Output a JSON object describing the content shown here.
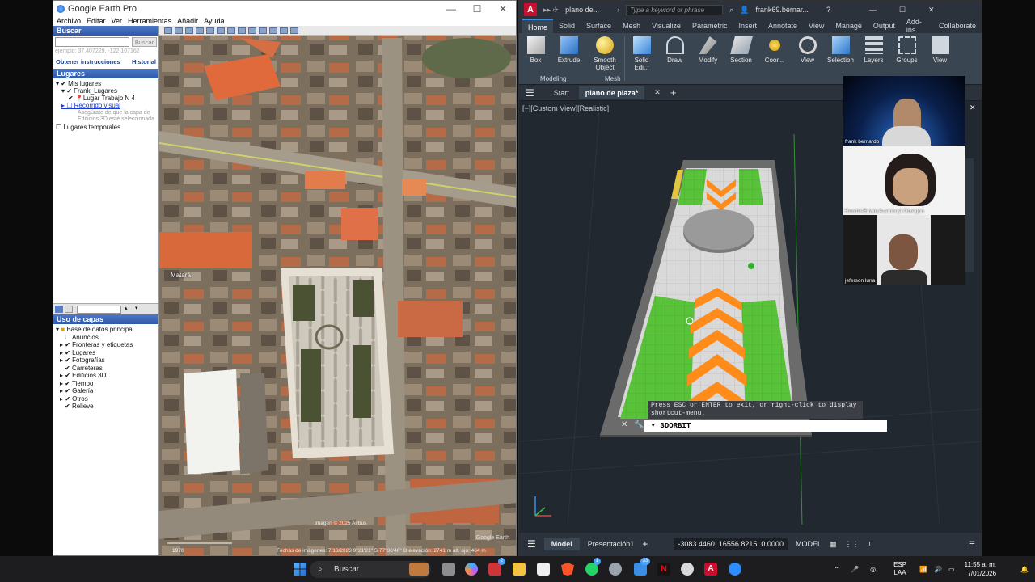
{
  "google_earth": {
    "title": "Google Earth Pro",
    "menu": [
      "Archivo",
      "Editar",
      "Ver",
      "Herramientas",
      "Añadir",
      "Ayuda"
    ],
    "search_header": "Buscar",
    "search_button": "Buscar",
    "search_placeholder": "ejemplo: 37.407229, -122.107162",
    "links": [
      "Obtener instrucciones",
      "Historial"
    ],
    "places_header": "Lugares",
    "places": [
      "Mis lugares",
      "Frank_Lugares",
      "Lugar Trabajo N 4",
      "Recorrido visual",
      "Asegúrate de que la capa de",
      "Edificios 3D esté seleccionada",
      "Lugares temporales"
    ],
    "layers_header": "Uso de capas",
    "layers": [
      "Base de datos principal",
      "Anuncios",
      "Fronteras y etiquetas",
      "Lugares",
      "Fotografías",
      "Carreteras",
      "Edificios 3D",
      "Tiempo",
      "Galería",
      "Otros",
      "Relieve"
    ],
    "map_label": "Matará",
    "imagery_credit": "Imagen © 2025 Airbus",
    "status_bar": "Fechas de imágenes: 7/13/2023   9°21'21\" S   77°36'40\" O   elevación: 2741 m   alt. ojo: 464 m",
    "scale": "1970",
    "watermark": "Google Earth"
  },
  "autocad": {
    "logo": "A",
    "doc_title": "plano de...",
    "search_placeholder": "Type a keyword or phrase",
    "user": "frank69.bernar...",
    "ribbon_tabs": [
      "Home",
      "Solid",
      "Surface",
      "Mesh",
      "Visualize",
      "Parametric",
      "Insert",
      "Annotate",
      "View",
      "Manage",
      "Output",
      "Add-ins",
      "Collaborate"
    ],
    "ribbon_buttons": [
      "Box",
      "Extrude",
      "Smooth Object",
      "Solid Edi...",
      "Draw",
      "Modify",
      "Section",
      "Coor...",
      "View",
      "Selection",
      "Layers",
      "Groups",
      "View"
    ],
    "panel_labels": [
      "Modeling",
      "Mesh"
    ],
    "doc_tabs": [
      "Start",
      "plano de plaza*"
    ],
    "viewport_label": "[−][Custom View][Realistic]",
    "cmd_hint": "Press ESC or ENTER to exit, or right-click to display shortcut-menu.",
    "cmd_value": "3DORBIT",
    "status_tabs": [
      "Model",
      "Presentación1"
    ],
    "coords": "-3083.4460, 16556.8215, 0.0000",
    "mode": "MODEL"
  },
  "participants": [
    {
      "name": "frank bernardo"
    },
    {
      "name": "Randal Edwin Azambuja Obregón"
    },
    {
      "name": "jeferson luna"
    }
  ],
  "taskbar": {
    "search_label": "Buscar",
    "language": "ESP",
    "language_sub": "LAA",
    "time": "11:55 a. m.",
    "date": "7/01/2026",
    "badge_teams": "2",
    "badge_whatsapp": "1",
    "badge_store": "33"
  },
  "colors": {
    "autocad_bg": "#212830",
    "grass": "#58c238",
    "chevron": "#ff8c1a",
    "paving": "#d9d9d9"
  }
}
